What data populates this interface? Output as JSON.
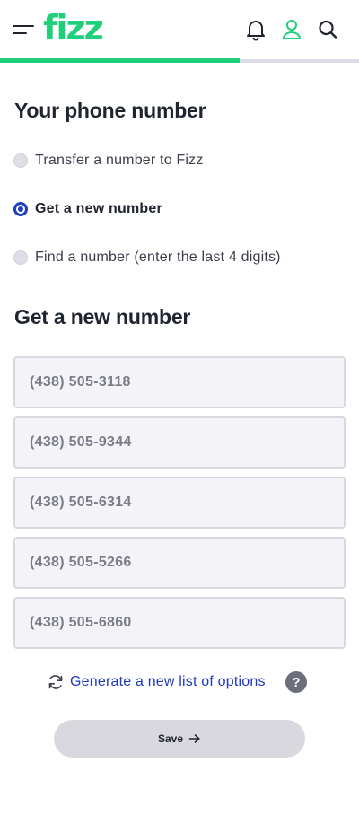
{
  "header": {
    "logo_text": "fizz",
    "progress": 0.667,
    "icons": [
      "menu-icon",
      "bell-icon",
      "user-icon",
      "search-icon"
    ],
    "colors": {
      "brand": "#1fcf7a",
      "accent": "#2039b8"
    }
  },
  "phone_section": {
    "title": "Your phone number",
    "options": [
      {
        "label": "Transfer a number to Fizz",
        "selected": false
      },
      {
        "label": "Get a new number",
        "selected": true
      },
      {
        "label": "Find a number (enter the last 4 digits)",
        "selected": false
      }
    ]
  },
  "new_number_section": {
    "title": "Get a new number",
    "numbers": [
      "(438) 505-3118",
      "(438) 505-9344",
      "(438) 505-6314",
      "(438) 505-5266",
      "(438) 505-6860"
    ],
    "generate_label": "Generate a new list of options",
    "help_symbol": "?"
  },
  "save": {
    "label": "Save"
  }
}
